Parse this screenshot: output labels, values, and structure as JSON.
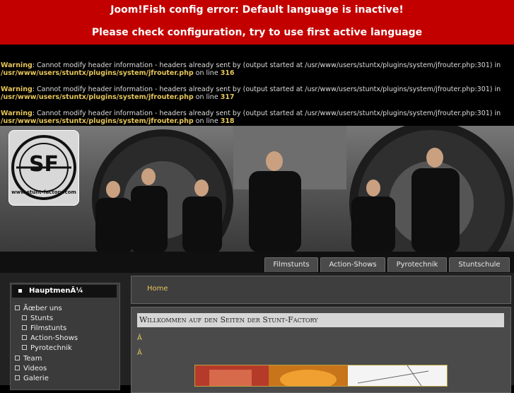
{
  "error": {
    "line1": "Joom!Fish config error: Default language is inactive!",
    "line2": "Please check configuration, try to use first active language"
  },
  "warnings": [
    {
      "label": "Warning",
      "message": ": Cannot modify header information - headers already sent by (output started at /usr/www/users/stuntx/plugins/system/jfrouter.php:301) in",
      "path": "/usr/www/users/stuntx/plugins/system/jfrouter.php",
      "on_line": " on line ",
      "line": "316"
    },
    {
      "label": "Warning",
      "message": ": Cannot modify header information - headers already sent by (output started at /usr/www/users/stuntx/plugins/system/jfrouter.php:301) in",
      "path": "/usr/www/users/stuntx/plugins/system/jfrouter.php",
      "on_line": " on line ",
      "line": "317"
    },
    {
      "label": "Warning",
      "message": ": Cannot modify header information - headers already sent by (output started at /usr/www/users/stuntx/plugins/system/jfrouter.php:301) in",
      "path": "/usr/www/users/stuntx/plugins/system/jfrouter.php",
      "on_line": " on line ",
      "line": "318"
    }
  ],
  "logo": {
    "text": "SF",
    "url_text": "www.stunt-factory.com"
  },
  "nav": {
    "tabs": [
      "Filmstunts",
      "Action-Shows",
      "Pyrotechnik",
      "Stuntschule"
    ]
  },
  "sidebar": {
    "title": "HauptmenÃ¼",
    "items": [
      {
        "label": "Ãœber uns"
      },
      {
        "label": "Stunts"
      },
      {
        "label": "Filmstunts"
      },
      {
        "label": "Action-Shows"
      },
      {
        "label": "Pyrotechnik"
      },
      {
        "label": "Team"
      },
      {
        "label": "Videos"
      },
      {
        "label": "Galerie"
      }
    ]
  },
  "breadcrumb": {
    "home": "Home"
  },
  "content": {
    "title": "Willkommen auf den Seiten der Stunt-Factory",
    "char1": "Â",
    "char2": "Â"
  },
  "colors": {
    "error_bg": "#c30000",
    "accent": "#e6c65a",
    "nav_tab": "#4a4a4a"
  }
}
